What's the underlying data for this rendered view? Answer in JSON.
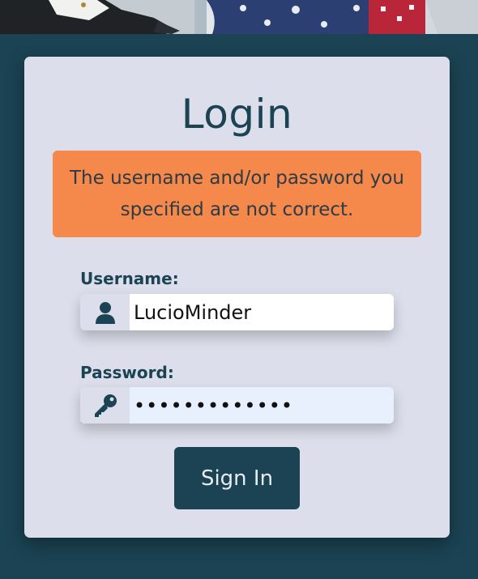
{
  "login": {
    "title": "Login",
    "error_message": "The username and/or password you specified are not correct.",
    "username_label": "Username:",
    "username_value": "LucioMinder",
    "password_label": "Password:",
    "password_value": "•••••••••••••",
    "sign_in_label": "Sign In"
  },
  "icons": {
    "username": "user-icon",
    "password": "key-icon"
  },
  "colors": {
    "background": "#1b4353",
    "card": "#dcdeeb",
    "error": "#f5884b",
    "button": "#1b4353",
    "accent_text": "#1b4353"
  }
}
